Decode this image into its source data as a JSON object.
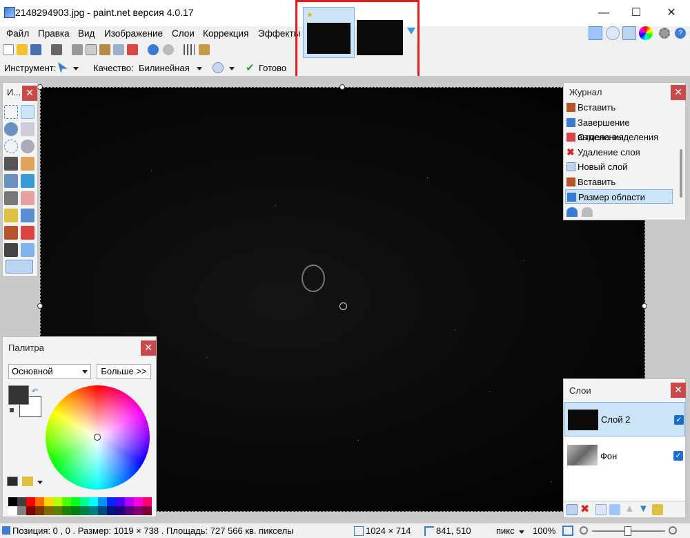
{
  "window": {
    "title": "2148294903.jpg - paint.net версия 4.0.17",
    "minimize": "—",
    "maximize": "☐",
    "close": "✕"
  },
  "menu": [
    "Файл",
    "Правка",
    "Вид",
    "Изображение",
    "Слои",
    "Коррекция",
    "Эффекты"
  ],
  "toolbar": {
    "tool_label": "Инструмент:",
    "quality_label": "Качество:",
    "quality_value": "Билинейная",
    "done_label": "Готово"
  },
  "tools_panel": {
    "title": "И..."
  },
  "history": {
    "title": "Журнал",
    "items": [
      "Вставить",
      "Завершение выделения",
      "Отмена выделения",
      "Удаление слоя",
      "Новый слой",
      "Вставить",
      "Размер области"
    ],
    "selected_index": 6
  },
  "palette": {
    "title": "Палитра",
    "mode": "Основной",
    "more_button": "Больше >>",
    "primary_color": "#333333",
    "secondary_color": "#ffffff"
  },
  "layers": {
    "title": "Слои",
    "items": [
      {
        "name": "Слой 2",
        "visible": true,
        "selected": true
      },
      {
        "name": "Фон",
        "visible": true,
        "selected": false
      }
    ]
  },
  "status": {
    "position": "Позиция: 0 , 0 . Размер: 1019 × 738 . Площадь: 727 566 кв. пикселы",
    "image_size": "1024 × 714",
    "cursor": "841, 510",
    "units": "пикс",
    "zoom": "100%"
  },
  "colors": {
    "accent": "#1d6ed1",
    "highlight": "#e41b1b",
    "selection": "#cce4f7"
  }
}
